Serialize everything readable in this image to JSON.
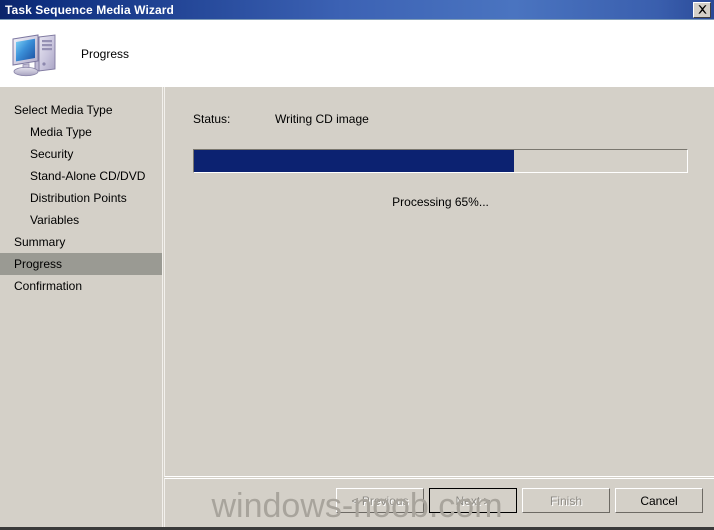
{
  "window": {
    "title": "Task Sequence Media Wizard",
    "close_icon": "close-icon"
  },
  "header": {
    "icon": "computer-icon",
    "title": "Progress"
  },
  "sidebar": {
    "items": [
      {
        "label": "Select Media Type",
        "indent": false,
        "selected": false
      },
      {
        "label": "Media Type",
        "indent": true,
        "selected": false
      },
      {
        "label": "Security",
        "indent": true,
        "selected": false
      },
      {
        "label": "Stand-Alone CD/DVD",
        "indent": true,
        "selected": false
      },
      {
        "label": "Distribution Points",
        "indent": true,
        "selected": false
      },
      {
        "label": "Variables",
        "indent": true,
        "selected": false
      },
      {
        "label": "Summary",
        "indent": false,
        "selected": false
      },
      {
        "label": "Progress",
        "indent": false,
        "selected": true
      },
      {
        "label": "Confirmation",
        "indent": false,
        "selected": false
      }
    ]
  },
  "main": {
    "status_label": "Status:",
    "status_value": "Writing CD image",
    "progress_percent": 65,
    "progress_text": "Processing 65%...",
    "progress_fill_color": "#0c2271"
  },
  "footer": {
    "buttons": [
      {
        "label": "< Previous",
        "disabled": true,
        "focused": false
      },
      {
        "label": "Next >",
        "disabled": true,
        "focused": true
      },
      {
        "label": "Finish",
        "disabled": true,
        "focused": false
      },
      {
        "label": "Cancel",
        "disabled": false,
        "focused": false
      }
    ]
  },
  "watermark": {
    "text": "windows-noob.com"
  }
}
